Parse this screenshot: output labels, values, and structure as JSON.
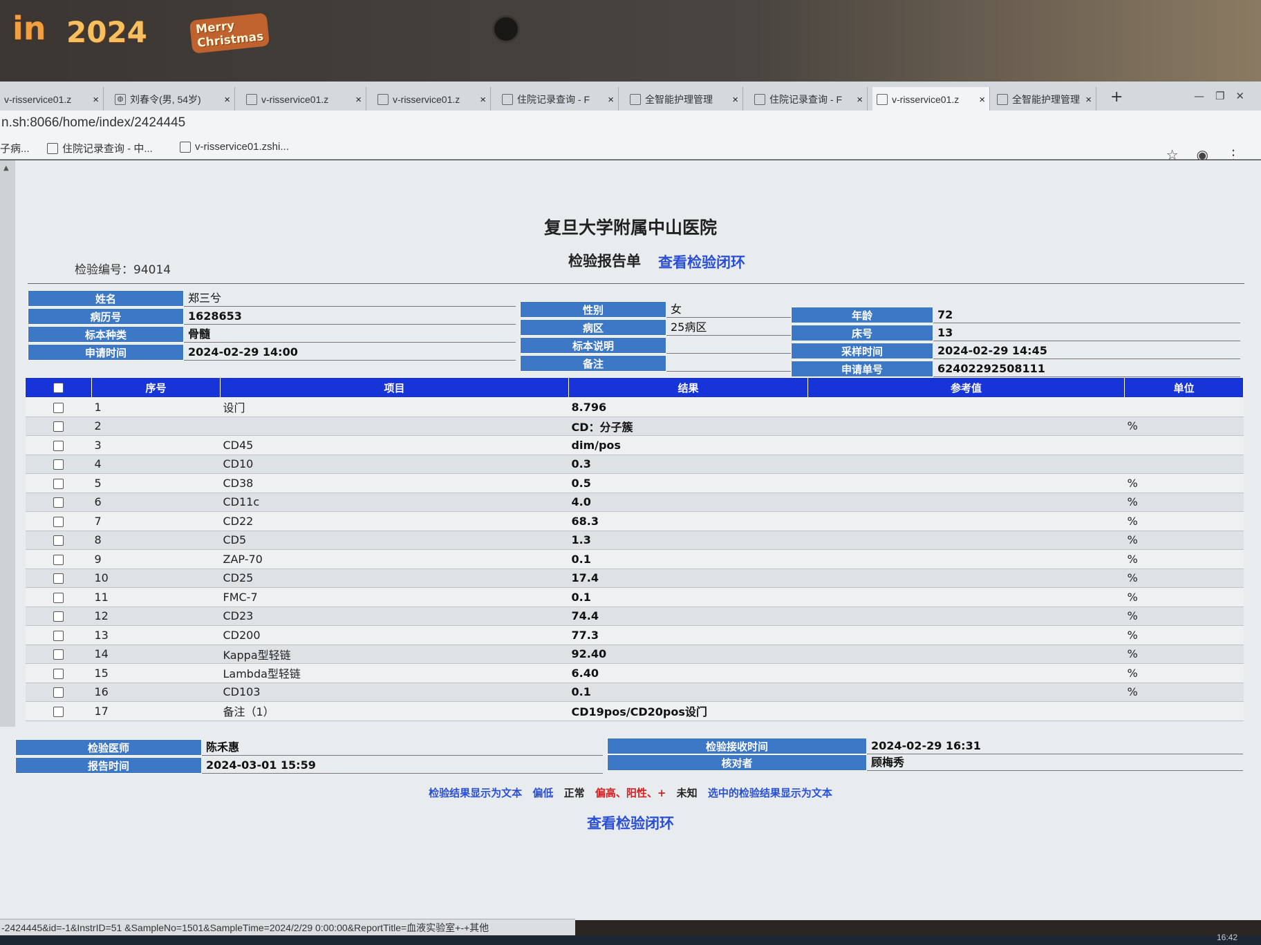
{
  "decor": {
    "in": "in",
    "year": "2024",
    "xmas_line1": "Merry",
    "xmas_line2": "Christmas"
  },
  "browser": {
    "tabs": [
      {
        "label": "v-risservice01.z",
        "icon": "document-icon"
      },
      {
        "label": "刘春令(男, 54岁)",
        "icon": "globe-icon"
      },
      {
        "label": "v-risservice01.z",
        "icon": "document-icon"
      },
      {
        "label": "v-risservice01.z",
        "icon": "document-icon"
      },
      {
        "label": "住院记录查询 - F",
        "icon": "app-icon"
      },
      {
        "label": "全智能护理管理",
        "icon": "app-icon"
      },
      {
        "label": "住院记录查询 - F",
        "icon": "app-icon"
      },
      {
        "label": "v-risservice01.z",
        "icon": "document-icon"
      },
      {
        "label": "全智能护理管理",
        "icon": "app-icon"
      }
    ],
    "url": "n.sh:8066/home/index/2424445",
    "bookmarks": [
      {
        "label": "子病..."
      },
      {
        "label": "住院记录查询 - 中..."
      },
      {
        "label": "v-risservice01.zshi..."
      }
    ]
  },
  "report": {
    "hospital": "复旦大学附属中山医院",
    "title": "检验报告单",
    "closed_loop_link": "查看检验闭环",
    "exam_no": "检验编号：94014",
    "patient": {
      "name_label": "姓名",
      "name": "郑三兮",
      "mrn_label": "病历号",
      "mrn": "1628653",
      "sample_type_label": "标本种类",
      "sample_type": "骨髓",
      "request_time_label": "申请时间",
      "request_time": "2024-02-29 14:00",
      "sex_label": "性别",
      "sex": "女",
      "ward_label": "病区",
      "ward": "25病区",
      "sample_desc_label": "标本说明",
      "sample_desc": "",
      "remark_label": "备注",
      "remark": "",
      "age_label": "年龄",
      "age": "72",
      "bed_label": "床号",
      "bed": "13",
      "collect_time_label": "采样时间",
      "collect_time": "2024-02-29 14:45",
      "request_no_label": "申请单号",
      "request_no": "62402292508111"
    },
    "table": {
      "headers": {
        "seq": "序号",
        "item": "项目",
        "result": "结果",
        "ref": "参考值",
        "unit": "单位"
      },
      "rows": [
        {
          "seq": "1",
          "item": "设门",
          "result": "8.796",
          "ref": "",
          "unit": ""
        },
        {
          "seq": "2",
          "item": "",
          "result": "CD：分子簇",
          "ref": "",
          "unit": "%"
        },
        {
          "seq": "3",
          "item": "CD45",
          "result": "dim/pos",
          "ref": "",
          "unit": ""
        },
        {
          "seq": "4",
          "item": "CD10",
          "result": "0.3",
          "ref": "",
          "unit": ""
        },
        {
          "seq": "5",
          "item": "CD38",
          "result": "0.5",
          "ref": "",
          "unit": "%"
        },
        {
          "seq": "6",
          "item": "CD11c",
          "result": "4.0",
          "ref": "",
          "unit": "%"
        },
        {
          "seq": "7",
          "item": "CD22",
          "result": "68.3",
          "ref": "",
          "unit": "%"
        },
        {
          "seq": "8",
          "item": "CD5",
          "result": "1.3",
          "ref": "",
          "unit": "%"
        },
        {
          "seq": "9",
          "item": "ZAP-70",
          "result": "0.1",
          "ref": "",
          "unit": "%"
        },
        {
          "seq": "10",
          "item": "CD25",
          "result": "17.4",
          "ref": "",
          "unit": "%"
        },
        {
          "seq": "11",
          "item": "FMC-7",
          "result": "0.1",
          "ref": "",
          "unit": "%"
        },
        {
          "seq": "12",
          "item": "CD23",
          "result": "74.4",
          "ref": "",
          "unit": "%"
        },
        {
          "seq": "13",
          "item": "CD200",
          "result": "77.3",
          "ref": "",
          "unit": "%"
        },
        {
          "seq": "14",
          "item": "Kappa型轻链",
          "result": "92.40",
          "ref": "",
          "unit": "%"
        },
        {
          "seq": "15",
          "item": "Lambda型轻链",
          "result": "6.40",
          "ref": "",
          "unit": "%"
        },
        {
          "seq": "16",
          "item": "CD103",
          "result": "0.1",
          "ref": "",
          "unit": "%"
        },
        {
          "seq": "17",
          "item": "备注（1）",
          "result": "CD19pos/CD20pos设门",
          "ref": "",
          "unit": ""
        }
      ]
    },
    "footer": {
      "doctor_label": "检验医师",
      "doctor": "陈禾惠",
      "report_time_label": "报告时间",
      "report_time": "2024-03-01 15:59",
      "receive_time_label": "检验接收时间",
      "receive_time": "2024-02-29 16:31",
      "checker_label": "核对者",
      "checker": "顾梅秀"
    },
    "legend": {
      "show_text": "检验结果显示为文本",
      "low": "偏低",
      "normal": "正常",
      "high": "偏高、阳性、+",
      "unknown": "未知",
      "selected_text": "选中的检验结果显示为文本"
    },
    "closed_loop_link_bottom": "查看检验闭环"
  },
  "status_url": "-2424445&id=-1&InstrID=51 &SampleNo=1501&SampleTime=2024/2/29 0:00:00&ReportTitle=血液实验室+-+其他",
  "clock": "16:42",
  "colors": {
    "header_blue": "#1634d8",
    "label_blue": "#3d78c7",
    "link_blue": "#2a4fd4",
    "high_red": "#d42020",
    "low_blue": "#2a4fd4"
  }
}
